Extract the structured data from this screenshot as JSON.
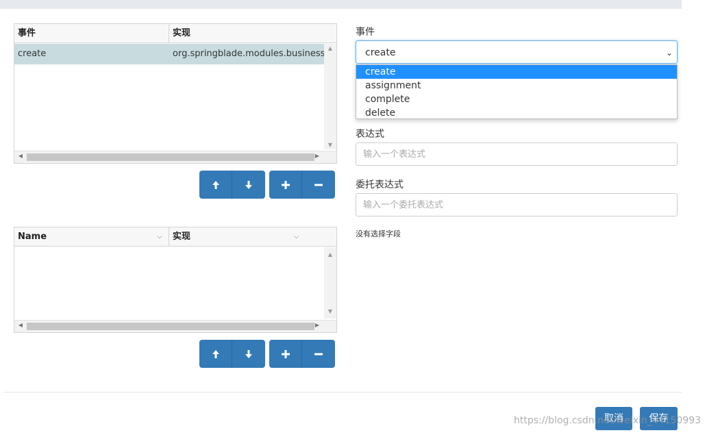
{
  "events_table": {
    "columns": [
      "事件",
      "实现"
    ],
    "rows": [
      {
        "event": "create",
        "implementation": "org.springblade.modules.business.l..."
      }
    ]
  },
  "fields_table": {
    "columns": [
      "Name",
      "实现"
    ]
  },
  "form": {
    "event_label": "事件",
    "event_value": "create",
    "event_options": [
      "create",
      "assignment",
      "complete",
      "delete"
    ],
    "expression_label": "表达式",
    "expression_placeholder": "输入一个表达式",
    "delegate_label": "委托表达式",
    "delegate_placeholder": "输入一个委托表达式",
    "no_field_text": "没有选择字段"
  },
  "footer": {
    "cancel_label": "取消",
    "save_label": "保存",
    "watermark": "https://blog.csdn.net/weixin_44150993"
  },
  "colors": {
    "primary": "#337ab7",
    "selected_row": "#c8dce0",
    "dropdown_highlight": "#1e90ff"
  }
}
